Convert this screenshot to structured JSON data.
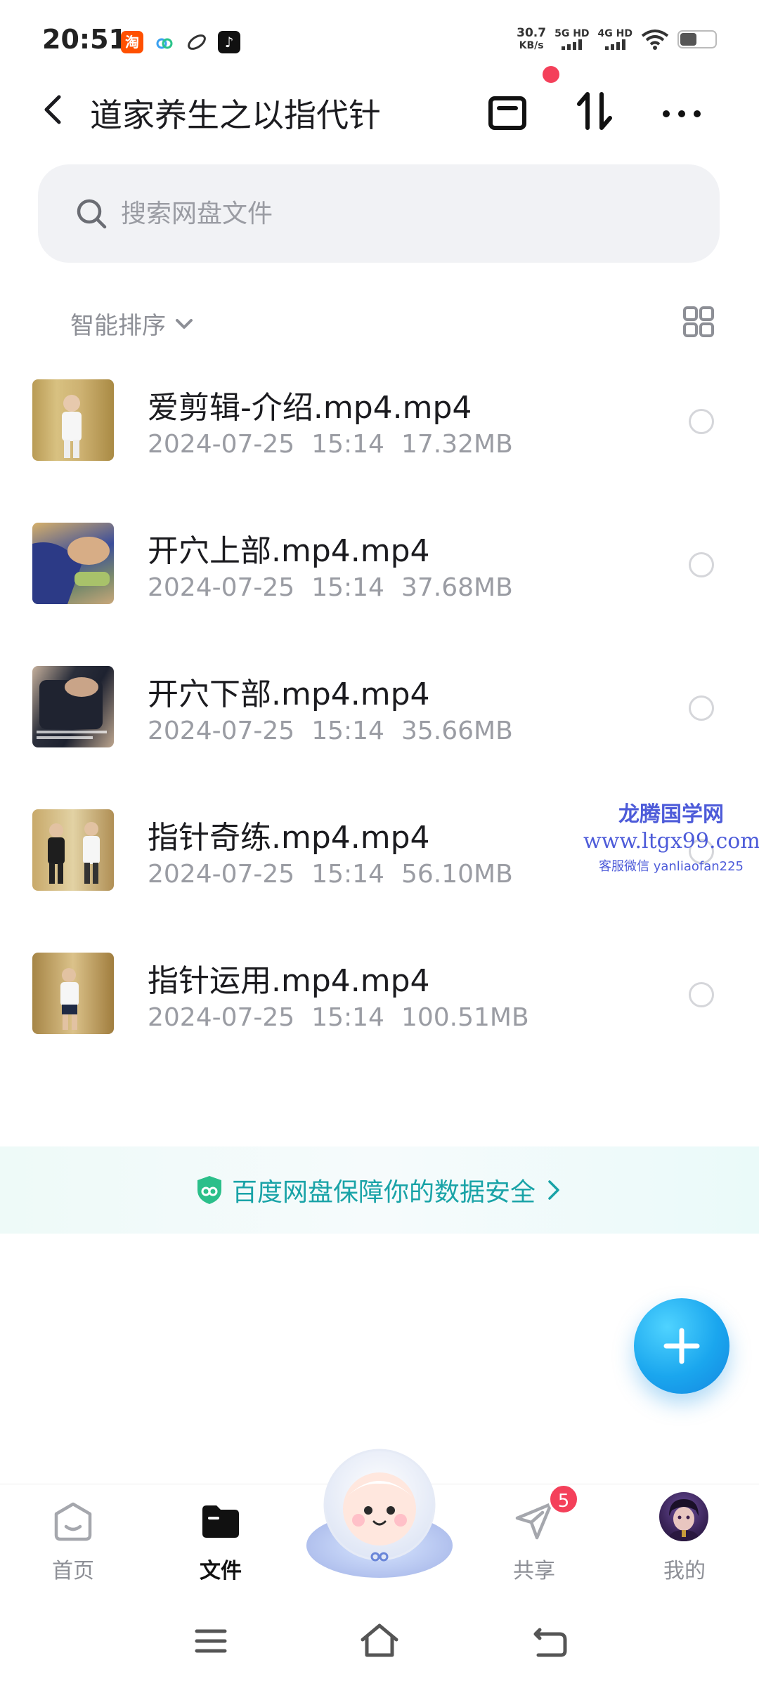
{
  "status_bar": {
    "time": "20:51",
    "taobao_glyph": "淘",
    "tiktok_glyph": "♪",
    "net_speed_value": "30.7",
    "net_speed_unit": "KB/s",
    "sim1_label": "5G HD",
    "sim2_label": "4G HD",
    "battery_level": 0.45
  },
  "header": {
    "title": "道家养生之以指代针"
  },
  "search": {
    "placeholder": "搜索网盘文件"
  },
  "sort": {
    "label": "智能排序"
  },
  "files": [
    {
      "name": "爱剪辑-介绍.mp4.mp4",
      "date": "2024-07-25",
      "time": "15:14",
      "size": "17.32MB"
    },
    {
      "name": "开穴上部.mp4.mp4",
      "date": "2024-07-25",
      "time": "15:14",
      "size": "37.68MB"
    },
    {
      "name": "开穴下部.mp4.mp4",
      "date": "2024-07-25",
      "time": "15:14",
      "size": "35.66MB"
    },
    {
      "name": "指针奇练.mp4.mp4",
      "date": "2024-07-25",
      "time": "15:14",
      "size": "56.10MB"
    },
    {
      "name": "指针运用.mp4.mp4",
      "date": "2024-07-25",
      "time": "15:14",
      "size": "100.51MB"
    }
  ],
  "watermark": {
    "title": "龙腾国学网",
    "url": "www.ltgx99.com",
    "contact": "客服微信 yanliaofan225"
  },
  "security_banner": {
    "text": "百度网盘保障你的数据安全"
  },
  "bottom_nav": {
    "items": [
      {
        "label": "首页",
        "icon": "home-icon"
      },
      {
        "label": "文件",
        "icon": "folder-icon",
        "active": true
      },
      {
        "label": "共享",
        "icon": "share-plane-icon"
      },
      {
        "label": "我的",
        "icon": "avatar"
      }
    ],
    "share_badge": "5"
  },
  "colors": {
    "accent": "#19a3a7",
    "fab": "#1aa6ee",
    "badge": "#f4405a",
    "watermark": "#4d5bd9"
  }
}
